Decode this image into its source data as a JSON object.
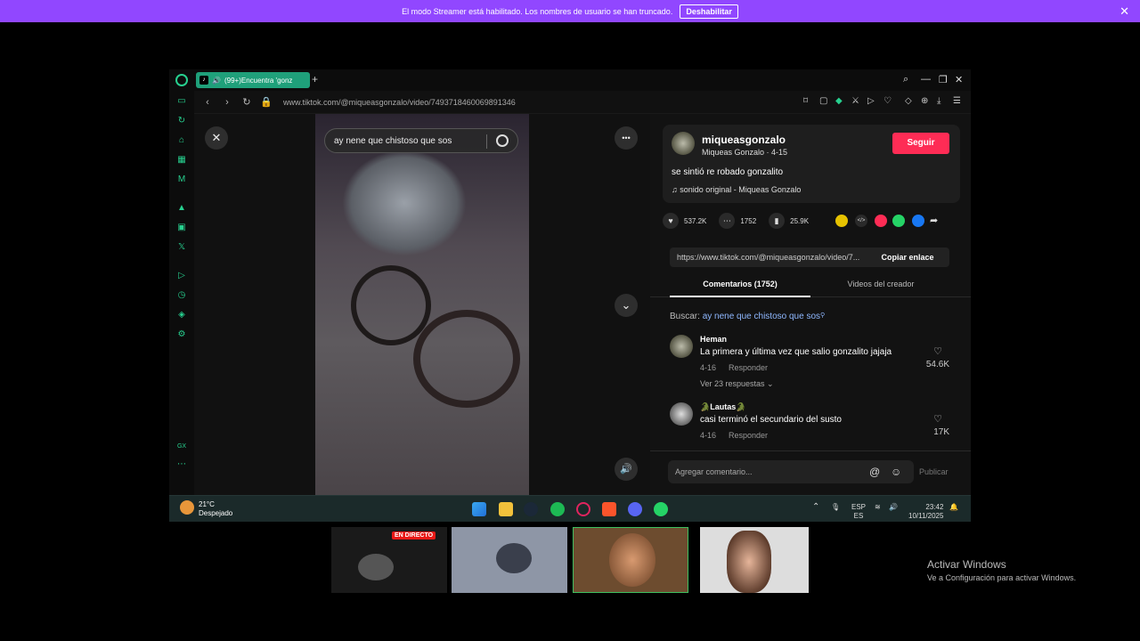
{
  "banner": {
    "message": "El modo Streamer está habilitado. Los nombres de usuario se han truncado.",
    "button": "Deshabilitar",
    "close": "✕"
  },
  "browser": {
    "tab_title": "(99+)Encuentra 'gonz",
    "new_tab": "+",
    "url": "www.tiktok.com/@miqueasgonzalo/video/7493718460069891346",
    "accent_color": "#1fa07a"
  },
  "video": {
    "search_query": "ay nene que chistoso que sos",
    "close": "✕",
    "more": "•••",
    "next": "⌄",
    "volume": "🔊"
  },
  "post": {
    "username": "miqueasgonzalo",
    "subtitle": "Miqueas Gonzalo · 4-15",
    "follow_label": "Seguir",
    "description": "se sintió re robado gonzalito",
    "sound": "sonido original - Miqueas Gonzalo",
    "likes": "537.2K",
    "comments": "1752",
    "saves": "25.9K",
    "link": "https://www.tiktok.com/@miqueasgonzalo/video/7...",
    "copy_label": "Copiar enlace"
  },
  "tabs": {
    "comments": "Comentarios (1752)",
    "creator_videos": "Videos del creador"
  },
  "search": {
    "prefix": "Buscar:",
    "term": "ay nene que chistoso que sos"
  },
  "comments": [
    {
      "name": "Heman",
      "text": "La primera y última vez que salio gonzalito jajaja",
      "date": "4-16",
      "reply": "Responder",
      "likes": "54.6K",
      "more": "Ver 23 respuestas ⌄"
    },
    {
      "name": "🐊Lautas🐊",
      "text": "casi terminó el secundario del susto",
      "date": "4-16",
      "reply": "Responder",
      "likes": "17K"
    }
  ],
  "compose": {
    "placeholder": "Agregar comentario...",
    "publish": "Publicar"
  },
  "taskbar": {
    "temp": "21°C",
    "weather": "Despejado",
    "lang1": "ESP",
    "lang2": "ES",
    "time": "23:42",
    "date": "10/11/2025"
  },
  "thumbs": {
    "live": "EN DIRECTO"
  },
  "windows": {
    "activate_title": "Activar Windows",
    "activate_sub": "Ve a Configuración para activar Windows."
  }
}
